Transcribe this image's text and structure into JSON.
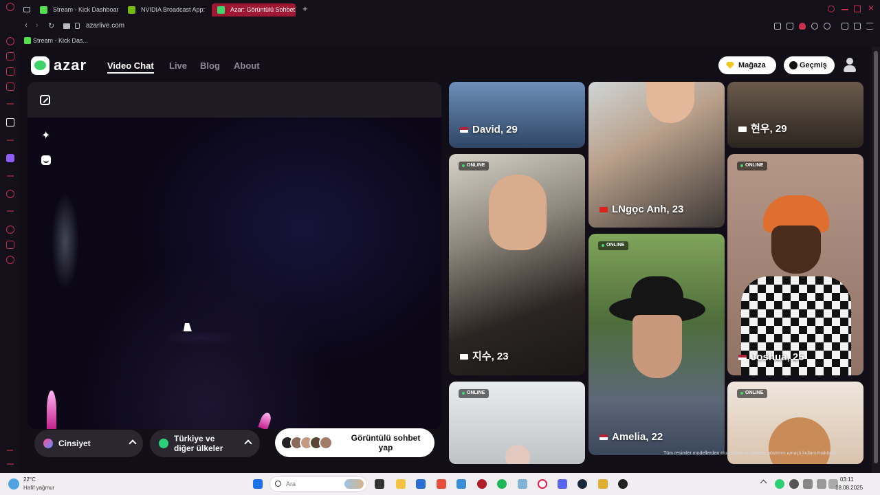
{
  "browser": {
    "tabs": [
      {
        "label": "Stream - Kick Dashboard",
        "favicon_color": "#52e04f"
      },
      {
        "label": "NVIDIA Broadcast App: A",
        "favicon_color": "#76b900"
      },
      {
        "label": "Azar: Görüntülü Sohbet, A",
        "favicon_color": "#3fd36b",
        "active": true
      }
    ],
    "url": "azarlive.com",
    "bookmark": "Stream - Kick Das...",
    "accent_color": "#c7304c"
  },
  "site": {
    "logo_text": "azar",
    "nav": {
      "video_chat": "Video Chat",
      "live": "Live",
      "blog": "Blog",
      "about": "About"
    },
    "store_label": "Mağaza",
    "history_label": "Geçmiş"
  },
  "controls": {
    "gender_label": "Cinsiyet",
    "region_label_line1": "Türkiye ve",
    "region_label_line2": "diğer ülkeler",
    "start_label_line1": "Görüntülü sohbet",
    "start_label_line2": "yap"
  },
  "gallery": {
    "online_label": "ONLINE",
    "disclaimer": "Tüm resimler modellerden oluşmakta ve sadece gösterim amaçlı kullanılmaktadır.",
    "cards": [
      {
        "name": "David, 29",
        "flag": "us"
      },
      {
        "name": "LNgọc Anh, 23",
        "flag": "vn"
      },
      {
        "name": "현우, 29",
        "flag": "kr"
      },
      {
        "name": "지수, 23",
        "flag": "kr"
      },
      {
        "name": "Amelia, 22",
        "flag": "us"
      },
      {
        "name": "Joshua, 25",
        "flag": "us"
      }
    ]
  },
  "taskbar": {
    "weather_temp": "22°C",
    "weather_text": "Hafif yağmur",
    "search_placeholder": "Ara",
    "time": "03:11",
    "date": "18.08.2025"
  }
}
